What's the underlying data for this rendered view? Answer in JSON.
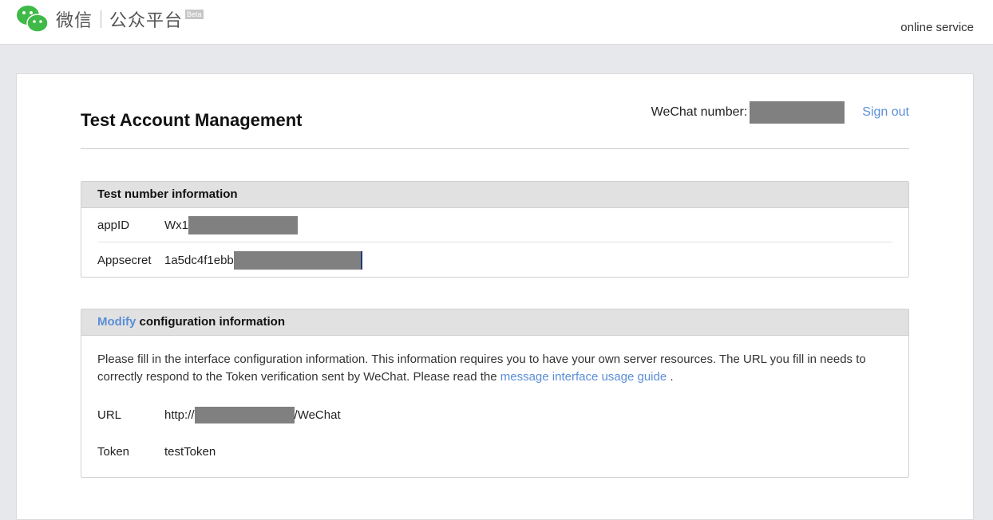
{
  "header": {
    "brand_wechat": "微信",
    "brand_platform": "公众平台",
    "brand_badge": "Beta",
    "online_service": "online service"
  },
  "page": {
    "title": "Test Account Management",
    "account_label": "WeChat number:",
    "sign_out": "Sign out"
  },
  "test_info": {
    "heading": "Test number information",
    "fields": [
      {
        "label": "appID",
        "value_prefix": "Wx1"
      },
      {
        "label": "Appsecret",
        "value_prefix": "1a5dc4f1ebb"
      }
    ]
  },
  "config": {
    "heading_link": "Modify",
    "heading_rest": " configuration information",
    "description": "Please fill in the interface configuration information. This information requires you to have your own server resources. The URL you fill in needs to correctly respond to the Token verification sent by WeChat. Please read the ",
    "guide_link": "message interface usage guide",
    "description_end": " .",
    "url_label": "URL",
    "url_prefix": "http://",
    "url_suffix": "/WeChat",
    "token_label": "Token",
    "token_value": "testToken"
  },
  "colors": {
    "link": "#5b8ed7",
    "brand_green": "#3fb947",
    "redaction": "#808080"
  }
}
